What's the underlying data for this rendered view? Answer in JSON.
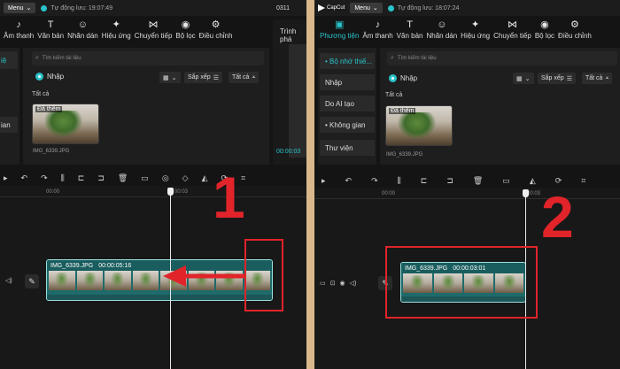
{
  "left": {
    "menu_label": "Menu",
    "save_status": "Tự động lưu: 19:07:49",
    "code_label": "0311",
    "tools": [
      "Âm thanh",
      "Văn bản",
      "Nhãn dán",
      "Hiệu ứng",
      "Chuyển tiếp",
      "Bộ lọc",
      "Điều chỉnh"
    ],
    "side_fragment": "iệ",
    "side_items": [
      "ian"
    ],
    "search_placeholder": "Tìm kiếm tài liệu",
    "import_label": "Nhập",
    "sort_label": "Sắp xếp",
    "filter_label": "Tất cả",
    "all_label": "Tất cả",
    "thumb_badge": "Đã thêm",
    "file_name": "IMG_6339.JPG",
    "preview_label": "Trình phá",
    "timecode": "00:00:03",
    "ruler_start": "00:00",
    "ruler_mid": "00:03",
    "clip_name": "IMG_6339.JPG",
    "clip_duration": "00:00:05:16",
    "step_number": "1"
  },
  "right": {
    "app_name": "CapCut",
    "menu_label": "Menu",
    "save_status": "Tự động lưu: 18:07:24",
    "tools": [
      "Phương tiện",
      "Âm thanh",
      "Văn bản",
      "Nhãn dán",
      "Hiệu ứng",
      "Chuyển tiếp",
      "Bộ lọc",
      "Điều chỉnh"
    ],
    "side_items": [
      "• Bộ nhớ thiế...",
      "Nhập",
      "Do AI tạo",
      "• Không gian",
      "Thư viện"
    ],
    "search_placeholder": "Tìm kiếm tài liệu",
    "import_label": "Nhập",
    "sort_label": "Sắp xếp",
    "filter_label": "Tất cả",
    "all_label": "Tất cả",
    "thumb_badge": "Đã thêm",
    "file_name": "IMG_6339.JPG",
    "ruler_start": "00:00",
    "ruler_mid": "00:03",
    "clip_name": "IMG_6339.JPG",
    "clip_duration": "00:00:03:01",
    "step_number": "2"
  },
  "colors": {
    "accent": "#29c3c9",
    "highlight_red": "#e0242a",
    "clip_teal": "#1f6a6a",
    "background": "#141414",
    "divider": "#d9b98b"
  }
}
